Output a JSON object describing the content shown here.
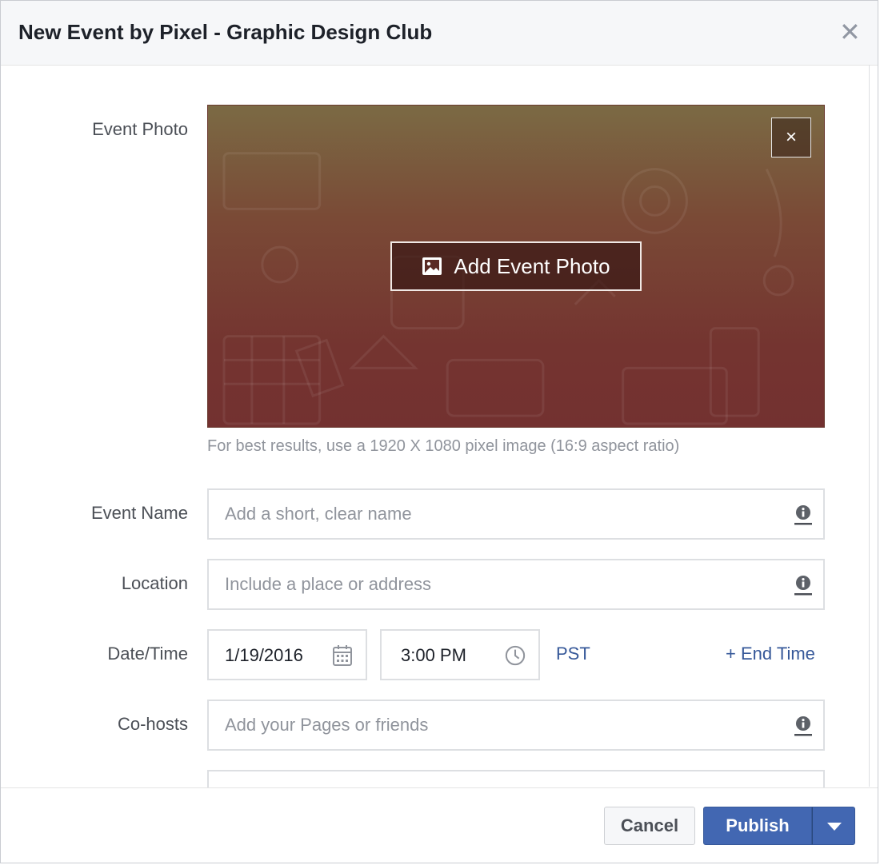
{
  "dialog": {
    "title": "New Event by Pixel - Graphic Design Club",
    "close_icon": "close-icon"
  },
  "photo": {
    "label": "Event Photo",
    "add_button_label": "Add Event Photo",
    "remove_glyph": "×",
    "hint": "For best results, use a 1920 X 1080 pixel image (16:9 aspect ratio)",
    "gradient_colors": [
      "#7b6a44",
      "#7a4a36",
      "#733130"
    ]
  },
  "fields": {
    "event_name": {
      "label": "Event Name",
      "placeholder": "Add a short, clear name",
      "value": ""
    },
    "location": {
      "label": "Location",
      "placeholder": "Include a place or address",
      "value": ""
    },
    "datetime": {
      "label": "Date/Time",
      "date": "1/19/2016",
      "time": "3:00 PM",
      "timezone": "PST",
      "end_time_link": "+ End Time"
    },
    "cohosts": {
      "label": "Co-hosts",
      "placeholder": "Add your Pages or friends",
      "value": ""
    }
  },
  "footer": {
    "cancel_label": "Cancel",
    "publish_label": "Publish"
  },
  "colors": {
    "accent": "#4267b2",
    "link": "#365899",
    "placeholder": "#90949c"
  }
}
